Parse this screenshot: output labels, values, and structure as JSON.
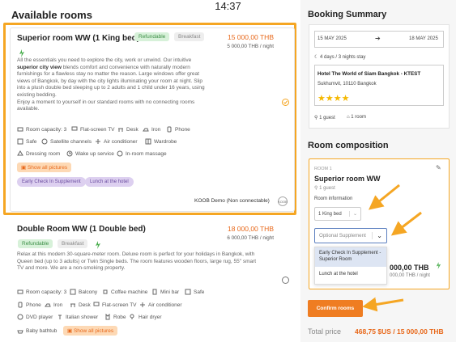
{
  "status_bar": {
    "time": "14:37"
  },
  "page": {
    "available_rooms_title": "Available rooms"
  },
  "rooms": [
    {
      "title": "Superior room WW (1 King bed)",
      "badges": [
        "Refundable",
        "Breakfast"
      ],
      "price": "15 000,00 THB",
      "price_per_night": "5 000,00 THB / night",
      "description": {
        "p1": "All the essentials you need to explore the city, work or unwind. Our intuitive",
        "p1_bold": "superior city view",
        "p1_rest": "blends comfort and convenience with naturally modern furnishings for a flawless stay no matter the reason. Large windows offer great views of Bangkok, by day with the city lights illuminating your room at night. Slip into a plush double bed sleeping up to 2 adults and 1 child under 16 years, using existing bedding.",
        "p2": "Enjoy a moment to yourself in our standard rooms with no connecting rooms available."
      },
      "amenities": [
        "Room capacity: 3",
        "Flat-screen TV",
        "Desk",
        "Iron",
        "Phone",
        "Safe",
        "Satellite channels",
        "Air conditioner",
        "Wardrobe",
        "Dressing room",
        "Wake up service",
        "In-room massage"
      ],
      "show_pictures": "Show all pictures",
      "supplements": [
        "Early Check In Supplement",
        "Lunch at the hotel"
      ],
      "provider": "KOOB Demo (Non connectable)",
      "provider_logo": "KOOB",
      "selected": true
    },
    {
      "title": "Double Room WW (1 Double bed)",
      "badges": [
        "Refundable",
        "Breakfast"
      ],
      "price": "18 000,00 THB",
      "price_per_night": "6 000,00 THB / night",
      "description": "Relax at this modern 30-square-meter room. Deluxe room is perfect for your holidays in Bangkok, with Queen bed (up to 3 adults) or Twin Single beds. The room features wooden floors, large rug, 55\" smart TV and more. We are a non-smoking property.",
      "amenities": [
        "Room capacity: 3",
        "Balcony",
        "Coffee machine",
        "Mini bar",
        "Safe",
        "Phone",
        "Iron",
        "Desk",
        "Flat-screen TV",
        "Air conditioner",
        "DVD player",
        "Italian shower",
        "Robe",
        "Hair dryer",
        "Baby bathtub"
      ],
      "show_pictures": "Show all pictures",
      "selected": false
    }
  ],
  "booking_summary": {
    "title": "Booking Summary",
    "check_in": "15 MAY 2025",
    "check_out": "18 MAY 2025",
    "stay": "4 days / 3 nights stay",
    "hotel_name": "Hotel The World of Siam Bangkok - KTEST",
    "hotel_address": "Sukhumvit, 10110 Bangkok",
    "stars": 4,
    "guests": "1 guest",
    "rooms": "1 room"
  },
  "room_composition": {
    "title": "Room composition",
    "room_label": "ROOM 1",
    "room_name": "Superior room WW",
    "guests": "1 guest",
    "room_info_label": "Room information",
    "bed_select": "1 King bed",
    "supplement_placeholder": "Optional Supplement",
    "dropdown_options": [
      "Early Check In Supplement - Superior Room",
      "Lunch at the hotel"
    ],
    "price": "000,00 THB",
    "price_per_night": "000,00 THB / night",
    "confirm_button": "Confirm rooms"
  },
  "total": {
    "label": "Total price",
    "value": "468,75 $US / 15 000,00 THB"
  },
  "colors": {
    "accent": "#ef7d22",
    "highlight_border": "#f5a623",
    "refundable_bg": "#d7f1d9",
    "supplement_bg": "#ddd0f0"
  }
}
